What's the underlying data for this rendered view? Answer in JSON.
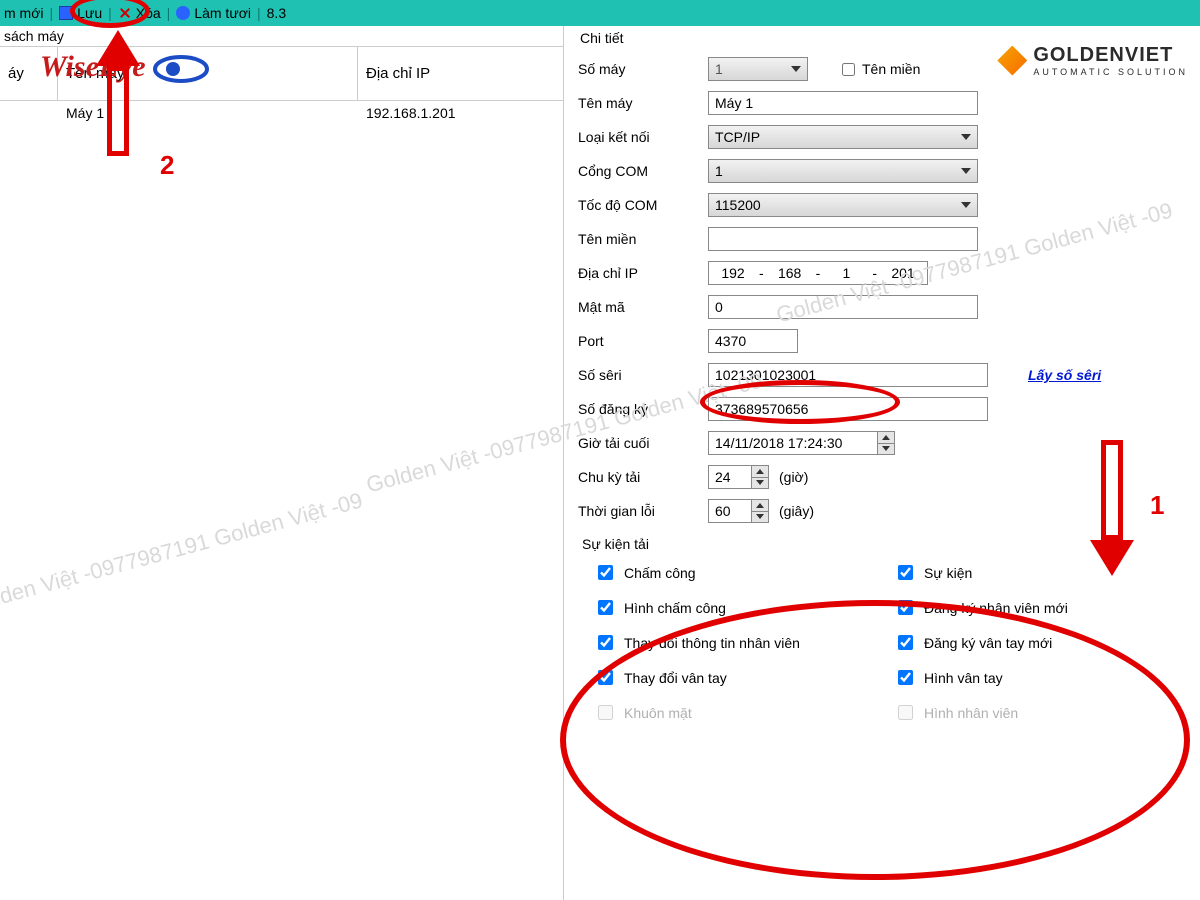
{
  "toolbar": {
    "new_label": "m mới",
    "save_label": "Lưu",
    "delete_label": "Xóa",
    "refresh_label": "Làm tươi",
    "version": "8.3"
  },
  "left_panel": {
    "title": "sách máy",
    "columns": {
      "id": "áy",
      "name": "Tên máy",
      "ip": "Địa chỉ IP"
    },
    "rows": [
      {
        "id": "",
        "name": "Máy 1",
        "ip": "192.168.1.201"
      }
    ]
  },
  "detail": {
    "title": "Chi tiết",
    "labels": {
      "machine_no": "Số máy",
      "machine_name": "Tên máy",
      "conn_type": "Loại kết nối",
      "com_port": "Cổng COM",
      "com_speed": "Tốc độ COM",
      "domain_name": "Tên miền",
      "ip": "Địa chỉ IP",
      "password": "Mật mã",
      "port": "Port",
      "serial": "Số sêri",
      "reg_no": "Số đăng ký",
      "last_dl": "Giờ tải cuối",
      "dl_cycle": "Chu kỳ tải",
      "err_time": "Thời gian lỗi",
      "events": "Sự kiện tải"
    },
    "values": {
      "machine_no": "1",
      "domain_checkbox_label": "Tên miền",
      "machine_name": "Máy 1",
      "conn_type": "TCP/IP",
      "com_port": "1",
      "com_speed": "115200",
      "domain_name": "",
      "ip": [
        "192",
        "168",
        "1",
        "201"
      ],
      "password": "0",
      "port": "4370",
      "serial": "1021301023001",
      "reg_no": "373689570656",
      "last_dl": "14/11/2018 17:24:30",
      "dl_cycle": "24",
      "dl_cycle_unit": "(giờ)",
      "err_time": "60",
      "err_time_unit": "(giây)"
    },
    "serial_link": "Lấy số sêri",
    "events": {
      "attendance": "Chấm công",
      "event": "Sự kiện",
      "att_image": "Hình chấm công",
      "new_emp": "Đăng ký nhân viên mới",
      "change_info": "Thay đổi thông tin nhân viên",
      "new_fp": "Đăng ký vân tay mới",
      "change_fp": "Thay đổi vân tay",
      "fp_image": "Hình vân tay",
      "face": "Khuôn mặt",
      "emp_image": "Hình nhân viên"
    }
  },
  "overlays": {
    "goldenviet": "GOLDENVIET",
    "goldenviet_sub": "AUTOMATIC SOLUTION",
    "wiseeye": "WiseEye",
    "watermark": "Golden Việt -0977987191 Golden Việt -09",
    "anno1": "1",
    "anno2": "2"
  }
}
